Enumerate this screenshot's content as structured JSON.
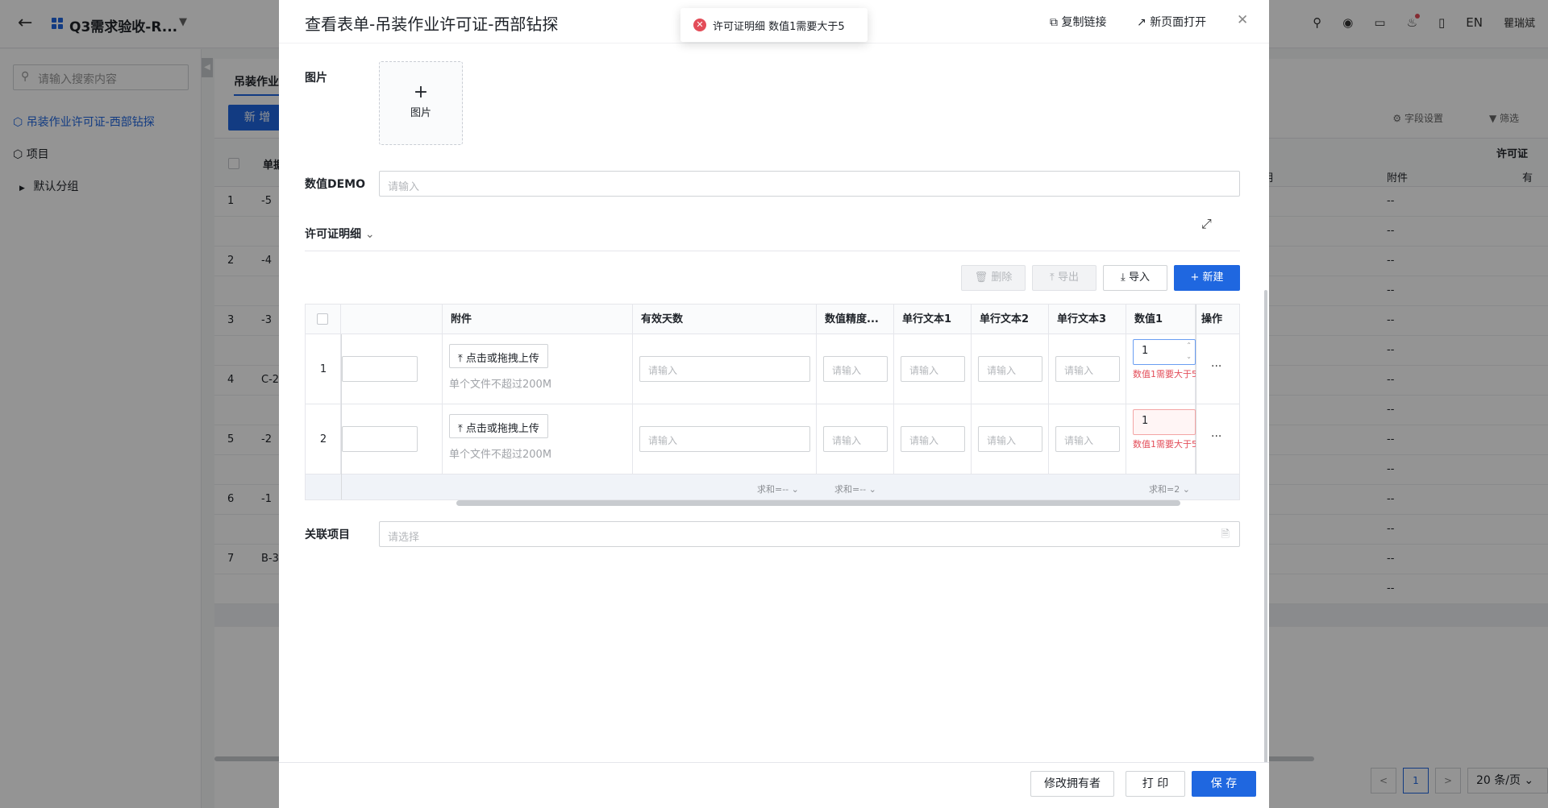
{
  "app": {
    "back_icon": "arrow-left-icon",
    "title": "Q3需求验收-R...",
    "lang": "EN",
    "user": "瞿瑞斌"
  },
  "sidebar": {
    "search_placeholder": "请输入搜索内容",
    "items": [
      {
        "label": "吊装作业许可证-西部钻探",
        "active": true
      },
      {
        "label": "项目"
      },
      {
        "label": "默认分组"
      }
    ]
  },
  "main": {
    "tab": "吊装作业",
    "new_button": "新 增",
    "field_settings": "字段设置",
    "filter": "筛选",
    "header_partial": "单据",
    "right_headers": [
      "许可证",
      "明",
      "附件",
      "有"
    ],
    "rows": [
      {
        "n": "1",
        "v": "-5",
        "att": "--",
        "att2": "--"
      },
      {
        "n": "2",
        "v": "-4",
        "att": "--",
        "att2": "--"
      },
      {
        "n": "3",
        "v": "-3",
        "att": "--",
        "att2": "--"
      },
      {
        "n": "4",
        "v": "C-2",
        "att": "--",
        "att2": "--"
      },
      {
        "n": "5",
        "v": "-2",
        "att": "--",
        "att2": "--"
      },
      {
        "n": "6",
        "v": "-1",
        "att": "--",
        "att2": "--"
      },
      {
        "n": "7",
        "v": "B-3",
        "att": "--",
        "att2": "--"
      }
    ],
    "pager": {
      "prev": "<",
      "page": "1",
      "next": ">",
      "size": "20 条/页"
    }
  },
  "modal": {
    "title": "查看表单-吊装作业许可证-西部钻探",
    "copy_link": "复制链接",
    "open_new_page": "新页面打开",
    "fields": {
      "image_label": "图片",
      "image_upload": "图片",
      "number_label": "数值DEMO",
      "number_placeholder": "请输入",
      "related_label": "关联项目",
      "related_placeholder": "请选择"
    },
    "subtable": {
      "title": "许可证明细",
      "buttons": {
        "delete": "删除",
        "export": "导出",
        "import": "导入",
        "new": "新建"
      },
      "headers": [
        "附件",
        "有效天数",
        "数值精度...",
        "单行文本1",
        "单行文本2",
        "单行文本3",
        "数值1",
        "操作"
      ],
      "upload_label": "点击或拖拽上传",
      "upload_hint": "单个文件不超过200M",
      "placeholder": "请输入",
      "rows": [
        {
          "num": "1",
          "value1": "1",
          "error": "数值1需要大于5"
        },
        {
          "num": "2",
          "value1": "1",
          "error": "数值1需要大于5"
        }
      ],
      "sums": [
        "求和=--",
        "求和=--",
        "求和=2"
      ],
      "more": "···"
    },
    "footer": {
      "change_owner": "修改拥有者",
      "print": "打 印",
      "save": "保 存"
    }
  },
  "toast": {
    "message": "许可证明细 数值1需要大于5",
    "type": "error"
  },
  "colors": {
    "primary": "#1f67e0",
    "error": "#e34d59"
  }
}
